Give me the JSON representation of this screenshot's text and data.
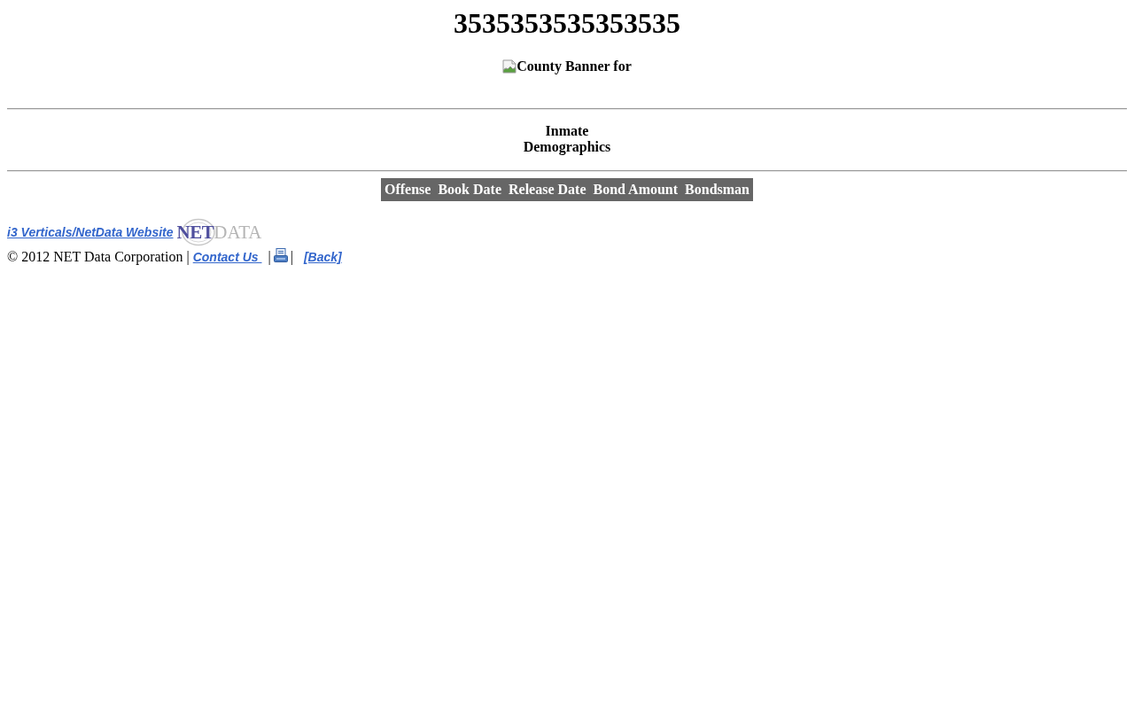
{
  "title": "3535353535353535",
  "banner": {
    "alt_text": "County Banner for"
  },
  "section_heading": "Inmate Demographics",
  "table": {
    "columns": [
      "Offense",
      "Book Date",
      "Release Date",
      "Bond Amount",
      "Bondsman"
    ]
  },
  "footer": {
    "website_link": "i3 Verticals/NetData Website",
    "logo": {
      "part_1": "NET",
      "part_2": "DATA"
    },
    "copyright": "© 2012 NET Data Corporation |",
    "contact_link": "Contact Us",
    "separator_1": "|",
    "separator_2": "|",
    "back_link": "[Back]"
  }
}
